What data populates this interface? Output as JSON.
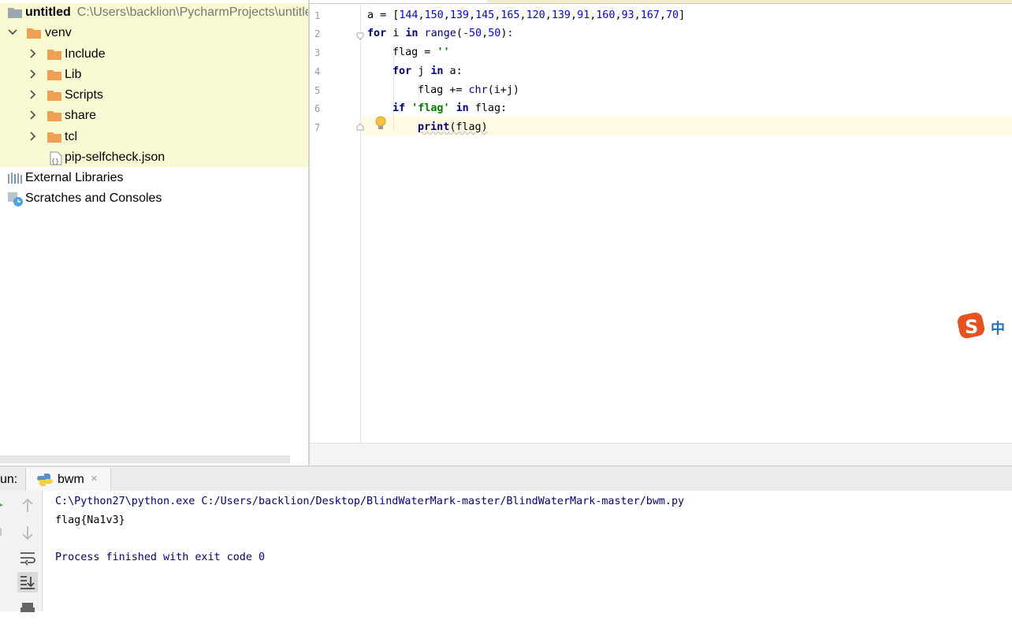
{
  "project": {
    "root_name": "untitled",
    "root_path": "C:\\Users\\backlion\\PycharmProjects\\untitled",
    "venv": "venv",
    "folders": [
      "Include",
      "Lib",
      "Scripts",
      "share",
      "tcl"
    ],
    "file": "pip-selfcheck.json",
    "external_libraries": "External Libraries",
    "scratches": "Scratches and Consoles"
  },
  "editor": {
    "line_numbers": [
      "1",
      "2",
      "3",
      "4",
      "5",
      "6",
      "7"
    ],
    "code": {
      "l1_a": "a = [",
      "l1_nums": [
        "144",
        "150",
        "139",
        "145",
        "165",
        "120",
        "139",
        "91",
        "160",
        "93",
        "167",
        "70"
      ],
      "l1_end": "]",
      "l2_for": "for",
      "l2_i": " i ",
      "l2_in": "in",
      "l2_range": " range",
      "l2_open": "(",
      "l2_n1": "-50",
      "l2_comma": ",",
      "l2_n2": "50",
      "l2_close": "):",
      "l3_flag": "flag = ",
      "l3_str": "''",
      "l4_for": "for",
      "l4_j": " j ",
      "l4_in": "in",
      "l4_a": " a:",
      "l5_flag": "flag += ",
      "l5_chr": "chr",
      "l5_args": "(i+j)",
      "l6_if": "if",
      "l6_str": " 'flag'",
      "l6_in": " in",
      "l6_rest": " flag:",
      "l7_print": "print",
      "l7_args": "(flag)"
    }
  },
  "ime": {
    "label": "中"
  },
  "run": {
    "label": "un:",
    "tab_name": "bwm",
    "tab_close": "×",
    "output": [
      "C:\\Python27\\python.exe C:/Users/backlion/Desktop/BlindWaterMark-master/BlindWaterMark-master/bwm.py",
      "flag{Na1v3}",
      "",
      "Process finished with exit code 0"
    ]
  },
  "colors": {
    "keyword": "#000080",
    "number": "#0000ff",
    "string": "#008000",
    "tree_highlight": "#fafad2",
    "caret_row": "#fffae3",
    "folder": "#f0a055"
  }
}
